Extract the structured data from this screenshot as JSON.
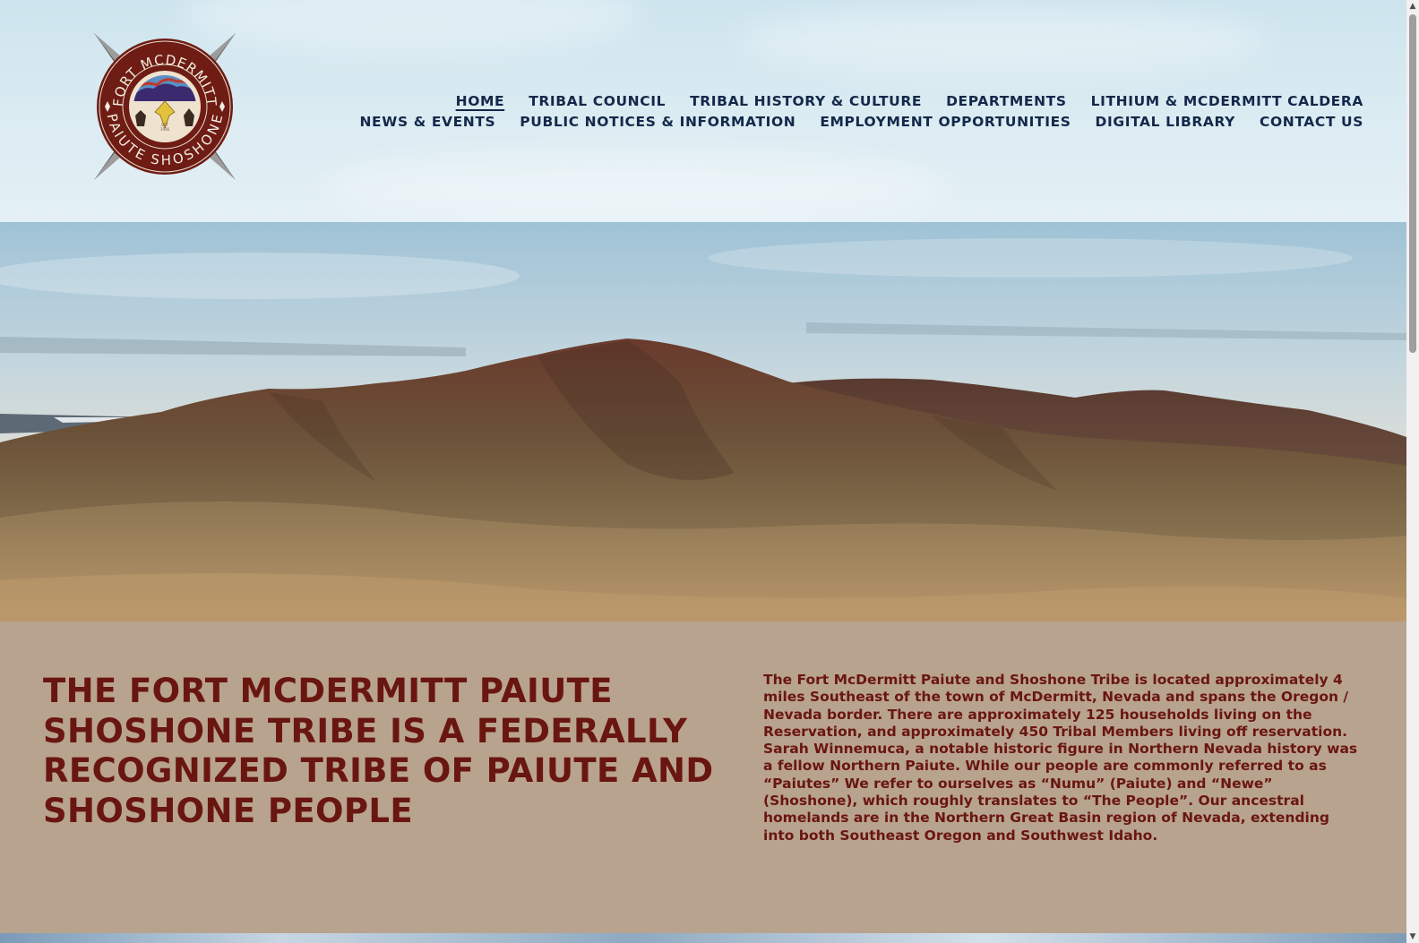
{
  "logo": {
    "top_text": "FORT MCDERMITT",
    "bottom_text": "PAIUTE SHOSHONE",
    "est_label": "EST",
    "est_year": "1936"
  },
  "nav": {
    "row1": [
      {
        "label": "HOME",
        "active": true
      },
      {
        "label": "TRIBAL COUNCIL"
      },
      {
        "label": "TRIBAL HISTORY & CULTURE"
      },
      {
        "label": "DEPARTMENTS"
      },
      {
        "label": "LITHIUM & MCDERMITT CALDERA"
      }
    ],
    "row2": [
      {
        "label": "NEWS & EVENTS"
      },
      {
        "label": "PUBLIC NOTICES & INFORMATION"
      },
      {
        "label": "EMPLOYMENT OPPORTUNITIES"
      },
      {
        "label": "DIGITAL LIBRARY"
      },
      {
        "label": "CONTACT US"
      }
    ]
  },
  "intro": {
    "headline": "THE FORT MCDERMITT PAIUTE SHOSHONE TRIBE IS A FEDERALLY RECOGNIZED TRIBE OF PAIUTE AND SHOSHONE PEOPLE",
    "body": "The Fort McDermitt Paiute and Shoshone Tribe is located approximately 4 miles Southeast of the town of McDermitt, Nevada and spans the Oregon / Nevada border. There are approximately 125 households living on the Reservation, and approximately 450 Tribal Members living off reservation. Sarah Winnemuca, a notable historic figure in Northern Nevada history was a fellow Northern Paiute. While our people are commonly referred to as “Paiutes” We refer to ourselves as “Numu” (Paiute) and “Newe” (Shoshone), which roughly translates to “The People”. Our ancestral homelands are in the Northern Great Basin region of Nevada, extending into both Southeast Oregon and Southwest Idaho."
  },
  "scrollbar": {
    "up_glyph": "▲",
    "down_glyph": "▼"
  },
  "colors": {
    "nav_text": "#14284a",
    "intro_bg": "#b8a38f",
    "intro_text": "#6a1610",
    "logo_maroon": "#6e1c14"
  }
}
